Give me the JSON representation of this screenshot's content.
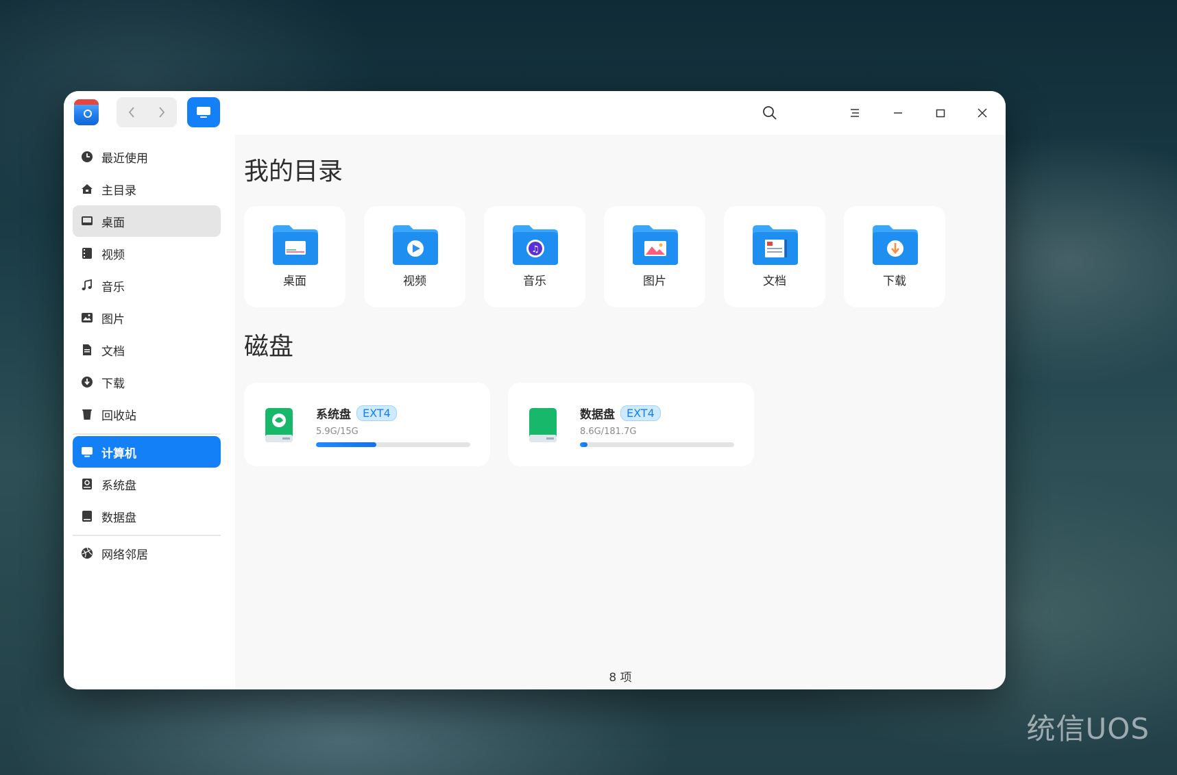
{
  "window": {
    "toolbar": {
      "back_label": "‹",
      "forward_label": "›"
    },
    "sidebar": {
      "items": [
        {
          "label": "最近使用",
          "icon": "clock-icon"
        },
        {
          "label": "主目录",
          "icon": "home-icon"
        },
        {
          "label": "桌面",
          "icon": "desktop-icon"
        },
        {
          "label": "视频",
          "icon": "video-icon"
        },
        {
          "label": "音乐",
          "icon": "music-icon"
        },
        {
          "label": "图片",
          "icon": "picture-icon"
        },
        {
          "label": "文档",
          "icon": "document-icon"
        },
        {
          "label": "下载",
          "icon": "download-icon"
        },
        {
          "label": "回收站",
          "icon": "trash-icon"
        },
        {
          "label": "计算机",
          "icon": "computer-icon"
        },
        {
          "label": "系统盘",
          "icon": "system-disk-icon"
        },
        {
          "label": "数据盘",
          "icon": "data-disk-icon"
        },
        {
          "label": "网络邻居",
          "icon": "network-icon"
        }
      ],
      "hovered": "桌面",
      "active": "计算机"
    },
    "main": {
      "my_dirs_title": "我的目录",
      "folders": [
        {
          "label": "桌面",
          "icon": "desktop-folder-icon"
        },
        {
          "label": "视频",
          "icon": "video-folder-icon"
        },
        {
          "label": "音乐",
          "icon": "music-folder-icon"
        },
        {
          "label": "图片",
          "icon": "picture-folder-icon"
        },
        {
          "label": "文档",
          "icon": "document-folder-icon"
        },
        {
          "label": "下载",
          "icon": "download-folder-icon"
        }
      ],
      "disks_title": "磁盘",
      "disks": [
        {
          "name": "系统盘",
          "fs": "EXT4",
          "usage": "5.9G/15G",
          "used_fraction": 0.39
        },
        {
          "name": "数据盘",
          "fs": "EXT4",
          "usage": "8.6G/181.7G",
          "used_fraction": 0.05
        }
      ]
    },
    "status": {
      "count": "8 项"
    }
  },
  "watermark": "统信UOS",
  "colors": {
    "accent": "#1480f8",
    "folder": "#1e8ff0",
    "disk_green": "#18b86a"
  }
}
